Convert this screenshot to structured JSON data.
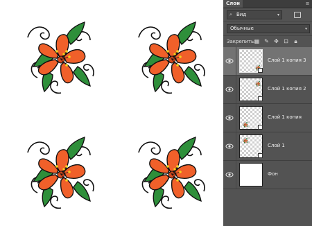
{
  "canvas": {
    "background": "#ffffff",
    "flower_count": 4
  },
  "panel": {
    "tab_label": "Слои",
    "tab_menu_icon": "panel-menu-icon",
    "filter_kind": {
      "icon": "search-icon",
      "label": "Вид"
    },
    "filter_icon": "filter-image-icon",
    "blend_mode": "Обычные",
    "lock_label": "Закрепить:",
    "lock_icons": [
      "lock-transparent-icon",
      "lock-image-icon",
      "lock-position-icon",
      "artboard-icon",
      "lock-all-icon"
    ],
    "layers": [
      {
        "name": "Слой 1 копия 3",
        "selected": true,
        "thumb": "transparent"
      },
      {
        "name": "Слой 1 копия 2",
        "selected": false,
        "thumb": "transparent"
      },
      {
        "name": "Слой 1 копия",
        "selected": false,
        "thumb": "transparent"
      },
      {
        "name": "Слой 1",
        "selected": false,
        "thumb": "transparent"
      },
      {
        "name": "Фон",
        "selected": false,
        "thumb": "white"
      }
    ]
  },
  "colors": {
    "petal": "#f0602a",
    "petal_stroke": "#1a1a1a",
    "leaf": "#2e8f3a",
    "stamen": "#f5d21c",
    "panel_bg": "#535353",
    "selected_row": "#737373"
  }
}
